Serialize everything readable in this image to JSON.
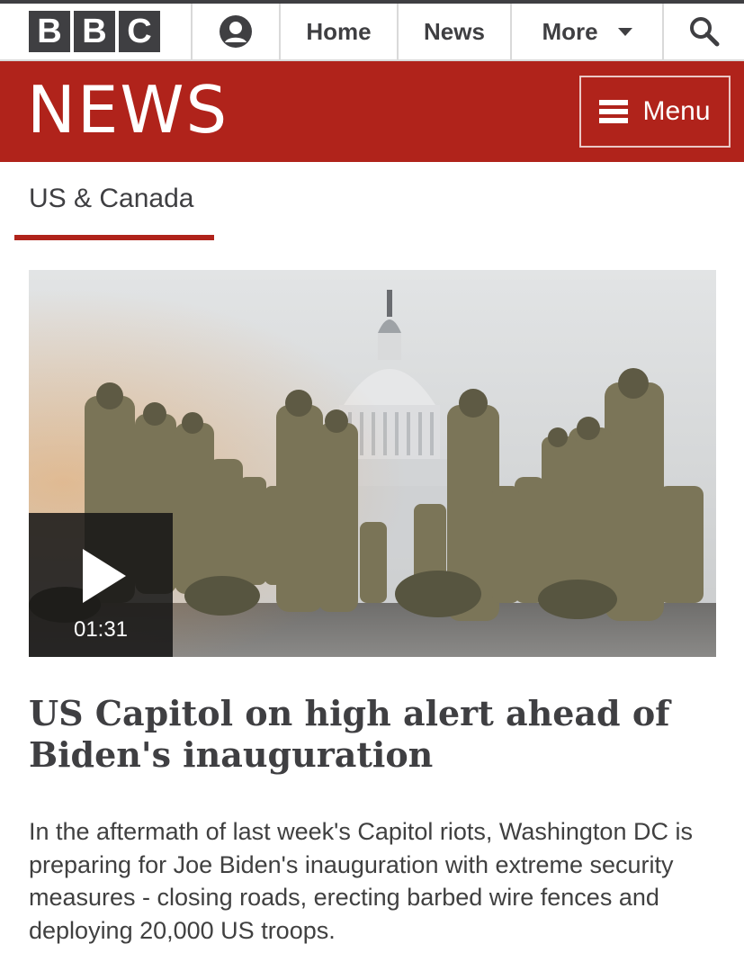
{
  "topbar": {
    "logo_letters": [
      "B",
      "B",
      "C"
    ],
    "nav": [
      {
        "label": "Home"
      },
      {
        "label": "News"
      },
      {
        "label": "More"
      }
    ]
  },
  "banner": {
    "title": "NEWS",
    "menu_label": "Menu"
  },
  "section": {
    "title": "US & Canada"
  },
  "video": {
    "duration": "01:31"
  },
  "article": {
    "headline": "US Capitol on high alert ahead of Biden's inauguration",
    "summary": "In the aftermath of last week's Capitol riots, Washington DC is preparing for Joe Biden's inauguration with extreme security measures - closing roads, erecting barbed wire fences and deploying 20,000 US troops."
  },
  "colors": {
    "brand_red": "#b0231b",
    "dark_gray": "#3f3f42"
  }
}
